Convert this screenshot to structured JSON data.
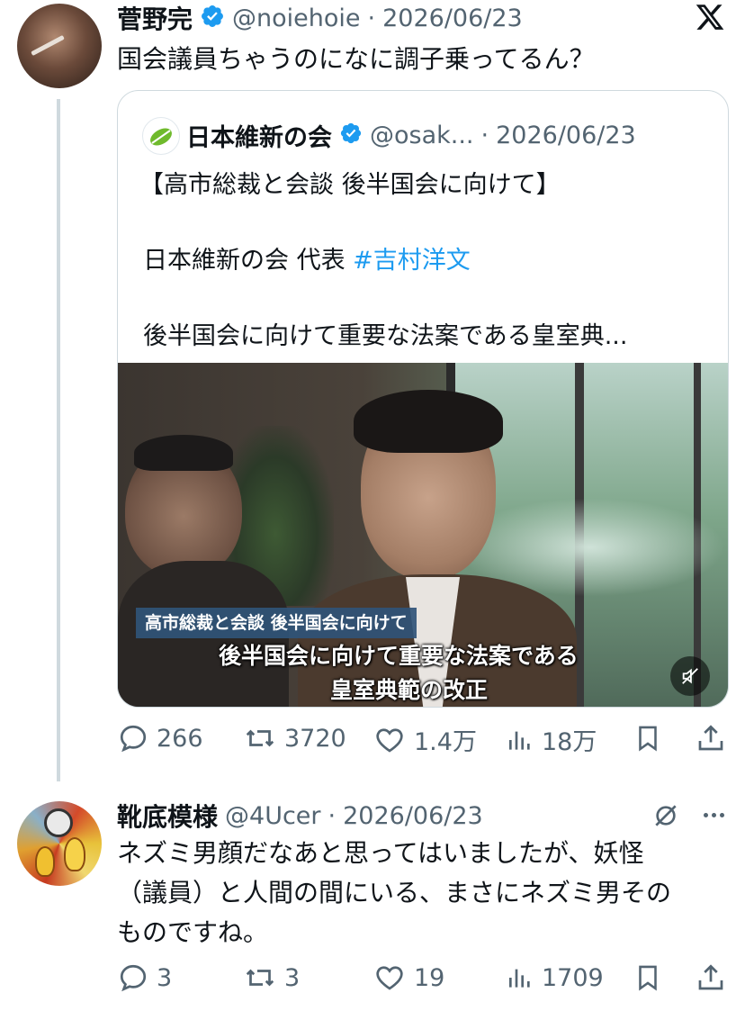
{
  "post": {
    "author_name": "菅野完",
    "handle": "@noiehoie",
    "sep": "·",
    "date": "2026/06/23",
    "text": "国会議員ちゃうのになに調子乗ってるん？",
    "x_logo_icon": "x-logo-icon"
  },
  "quoted": {
    "author_name": "日本維新の会",
    "handle": "@osak...",
    "sep": "·",
    "date": "2026/06/23",
    "line1": "【高市総裁と会談 後半国会に向けて】",
    "line2_prefix": "日本維新の会 代表 ",
    "line2_hashtag": "#吉村洋文",
    "line3": "後半国会に向けて重要な法案である皇室典...",
    "video": {
      "caption_bar": "高市総裁と会談 後半国会に向けて",
      "subtitle1": "後半国会に向けて重要な法案である",
      "subtitle2": "皇室典範の改正",
      "mute_icon": "speaker-muted-icon"
    }
  },
  "post_actions": {
    "replies": "266",
    "reposts": "3720",
    "likes": "1.4万",
    "views": "18万"
  },
  "reply": {
    "author_name": "靴底模様",
    "handle": "@4Ucer",
    "sep": "·",
    "date": "2026/06/23",
    "text_line1": "ネズミ男顔だなあと思ってはいましたが、妖怪",
    "text_line2": "（議員）と人間の間にいる、まさにネズミ男その",
    "text_line3": "ものですね。",
    "actions": {
      "replies": "3",
      "reposts": "3",
      "likes": "19",
      "views": "1709"
    }
  },
  "colors": {
    "verified": "#1d9bf0",
    "secondary_text": "#536471",
    "hashtag": "#1d9bf0",
    "border": "#cfd9de"
  }
}
